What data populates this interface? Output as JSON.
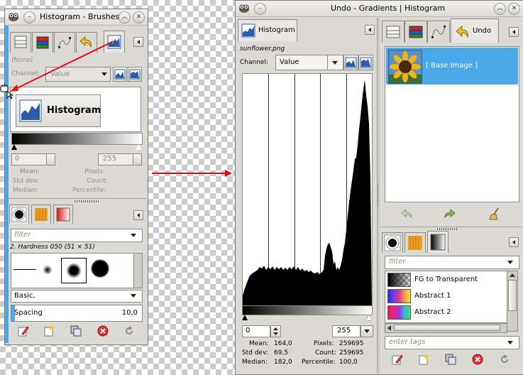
{
  "left_window": {
    "title": "Histogram - Brushes",
    "dock_title": "(None)",
    "channel_label": "Channel:",
    "channel_value": "Value",
    "histogram_button_label": "Histogram",
    "range_start": "0",
    "range_end": "255",
    "stats": {
      "mean_label": "Mean:",
      "std_label": "Std dev:",
      "median_label": "Median:",
      "pixels_label": "Pixels:",
      "count_label": "Count:",
      "percentile_label": "Percentile:"
    },
    "filter_placeholder": "filter",
    "brush_name": "2. Hardness 050 (51 × 51)",
    "brush_preset": "Basic,",
    "spacing_label": "Spacing",
    "spacing_value": "10,0"
  },
  "histogram_window": {
    "title": "Undo - Gradients | Histogram",
    "tab_label": "Histogram",
    "image_name": "sunflower.png",
    "channel_label": "Channel:",
    "channel_value": "Value",
    "range_start": "0",
    "range_end": "255",
    "stats": {
      "mean_label": "Mean:",
      "mean_value": "164,0",
      "std_label": "Std dev:",
      "std_value": "69,5",
      "median_label": "Median:",
      "median_value": "182,0",
      "pixels_label": "Pixels:",
      "pixels_value": "259695",
      "count_label": "Count:",
      "count_value": "259695",
      "percentile_label": "Percentile:",
      "percentile_value": "100,0"
    }
  },
  "undo_panel": {
    "tab_label": "Undo",
    "entries": [
      {
        "label": "[ Base Image ]",
        "selected": true
      }
    ]
  },
  "gradients_panel": {
    "filter_placeholder": "filter",
    "gradients": [
      {
        "name": "FG to Transparent"
      },
      {
        "name": "Abstract 1"
      },
      {
        "name": "Abstract 2"
      }
    ],
    "tags_placeholder": "enter tags"
  },
  "colors": {
    "selection": "#4aa8e8",
    "arrow": "#e01010",
    "window_bg": "#dcdad5"
  }
}
